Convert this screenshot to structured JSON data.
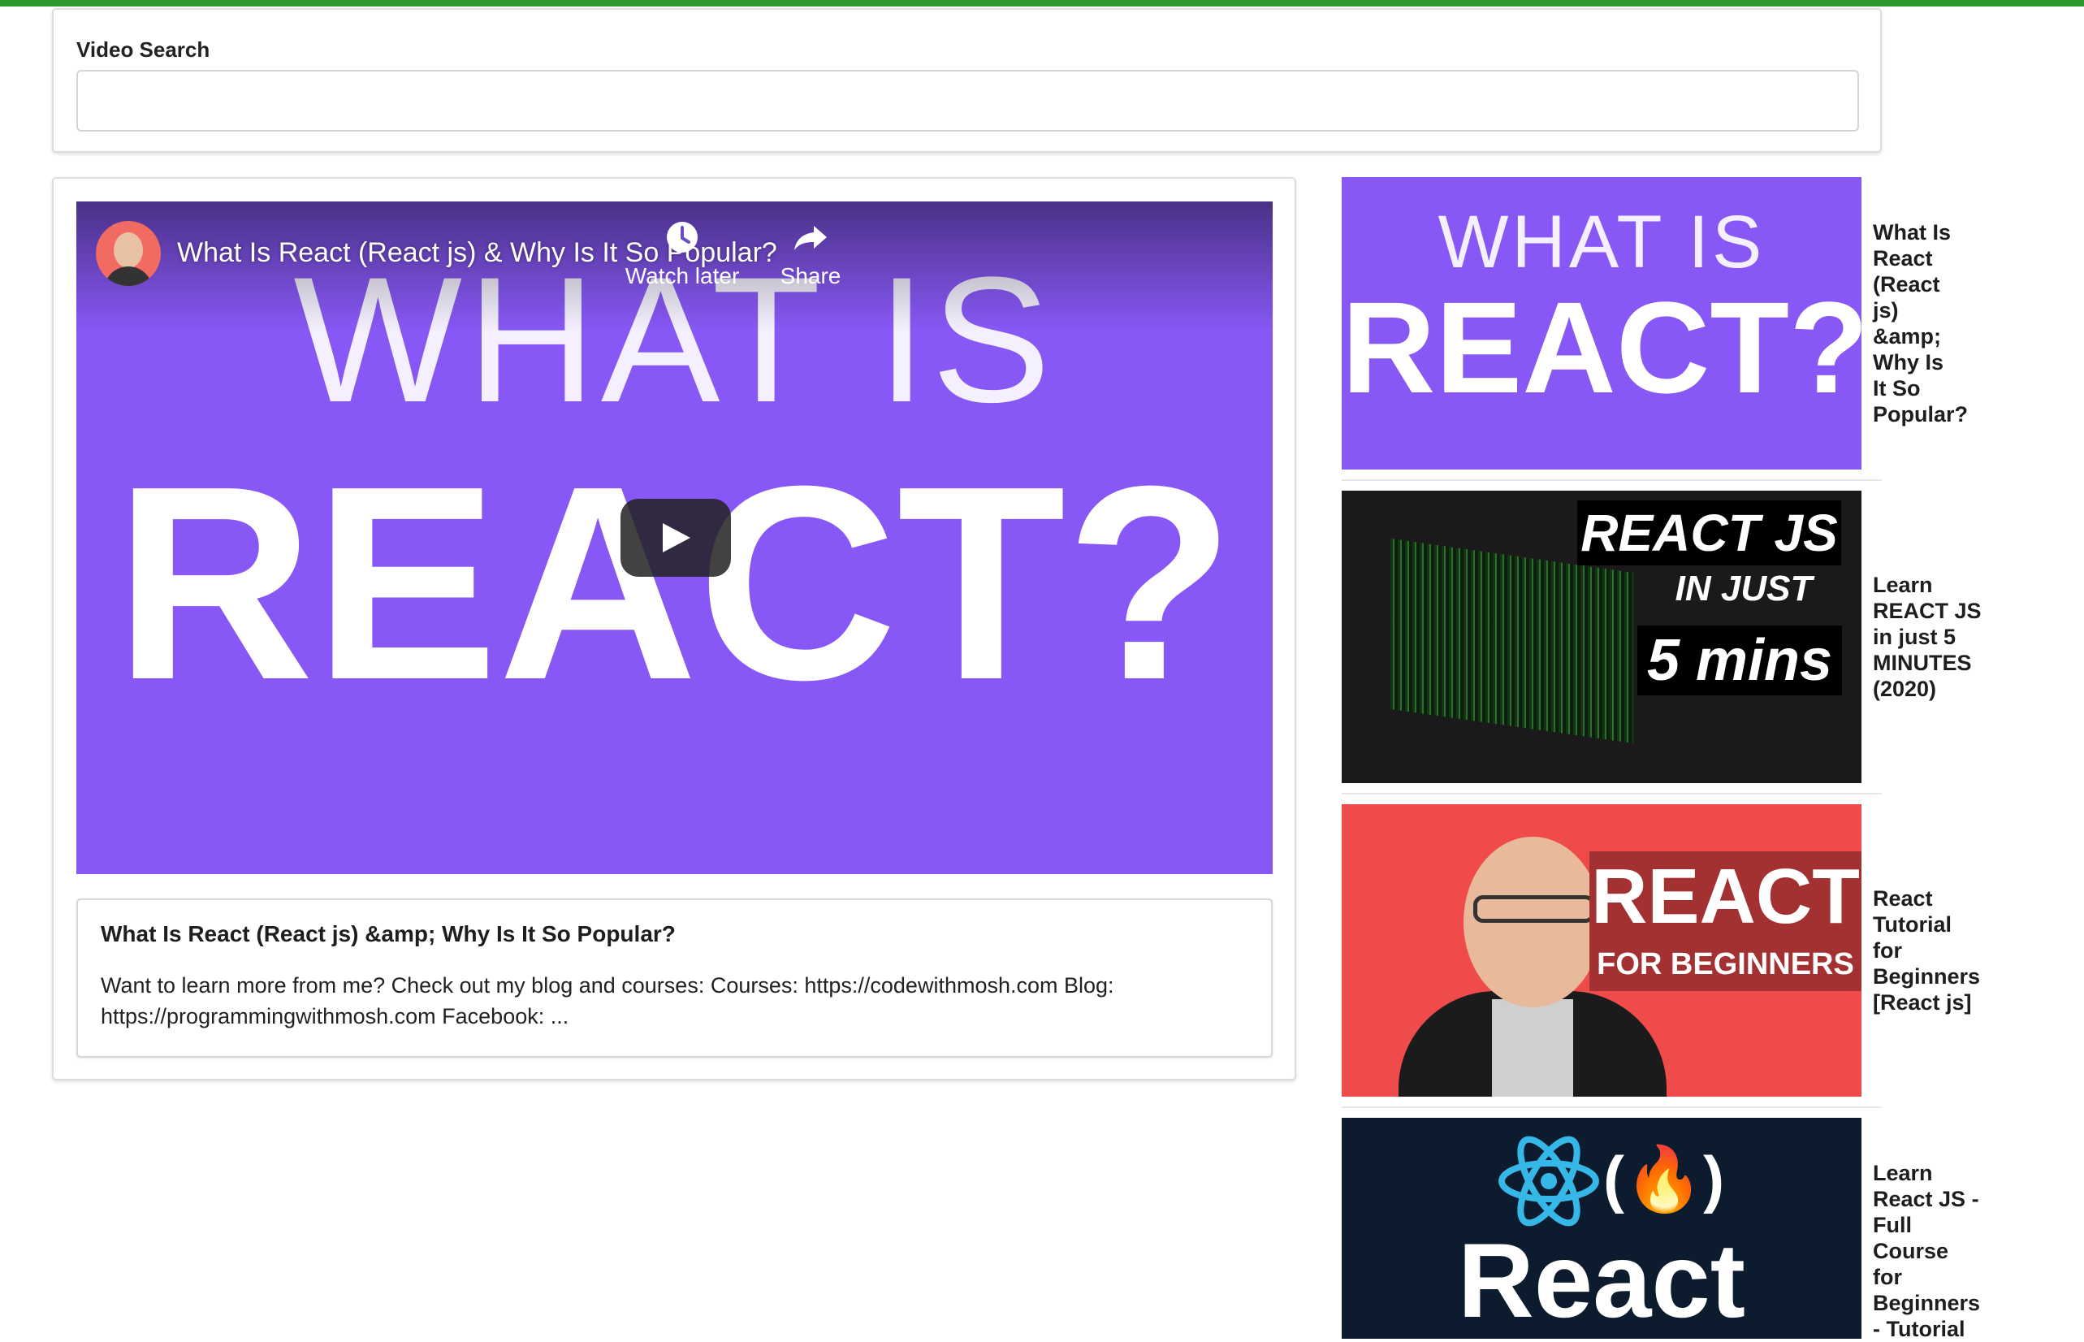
{
  "search": {
    "label": "Video Search",
    "value": ""
  },
  "player": {
    "title": "What Is React (React js) & Why Is It So Popular?",
    "thumb_line1": "WHAT IS",
    "thumb_line2": "REACT?",
    "watch_later_label": "Watch later",
    "share_label": "Share",
    "background_color": "#8758f5"
  },
  "detail": {
    "title": "What Is React (React js) &amp; Why Is It So Popular?",
    "description": "Want to learn more from me? Check out my blog and courses: Courses: https://codewithmosh.com Blog: https://programmingwithmosh.com Facebook: ..."
  },
  "video_list": [
    {
      "title_lines": [
        "What Is",
        "React",
        "(React",
        "js)",
        "&amp;",
        "Why Is",
        "It So",
        "Popular?"
      ],
      "thumb_text": [
        "WHAT IS",
        "REACT?"
      ],
      "thumb_color": "#8758f5"
    },
    {
      "title_lines": [
        "Learn",
        "REACT JS",
        "in just 5",
        "MINUTES",
        "(2020)"
      ],
      "thumb_text": [
        "REACT JS",
        "IN JUST",
        "5 mins"
      ],
      "thumb_color": "#1a1a1a"
    },
    {
      "title_lines": [
        "React",
        "Tutorial",
        "for",
        "Beginners",
        "[React js]"
      ],
      "thumb_text": [
        "REACT",
        "FOR BEGINNERS"
      ],
      "thumb_color": "#ef4b4b"
    },
    {
      "title_lines": [
        "Learn",
        "React JS -",
        "Full",
        "Course",
        "for",
        "Beginners",
        "- Tutorial"
      ],
      "thumb_text": [
        "(🔥)",
        "React"
      ],
      "thumb_color": "#0d1b2e"
    }
  ],
  "icons": {
    "avatar": "channel-avatar",
    "watch_later": "clock-icon",
    "share": "share-icon",
    "play": "play-icon"
  },
  "accent_color": "#2e9a2e"
}
